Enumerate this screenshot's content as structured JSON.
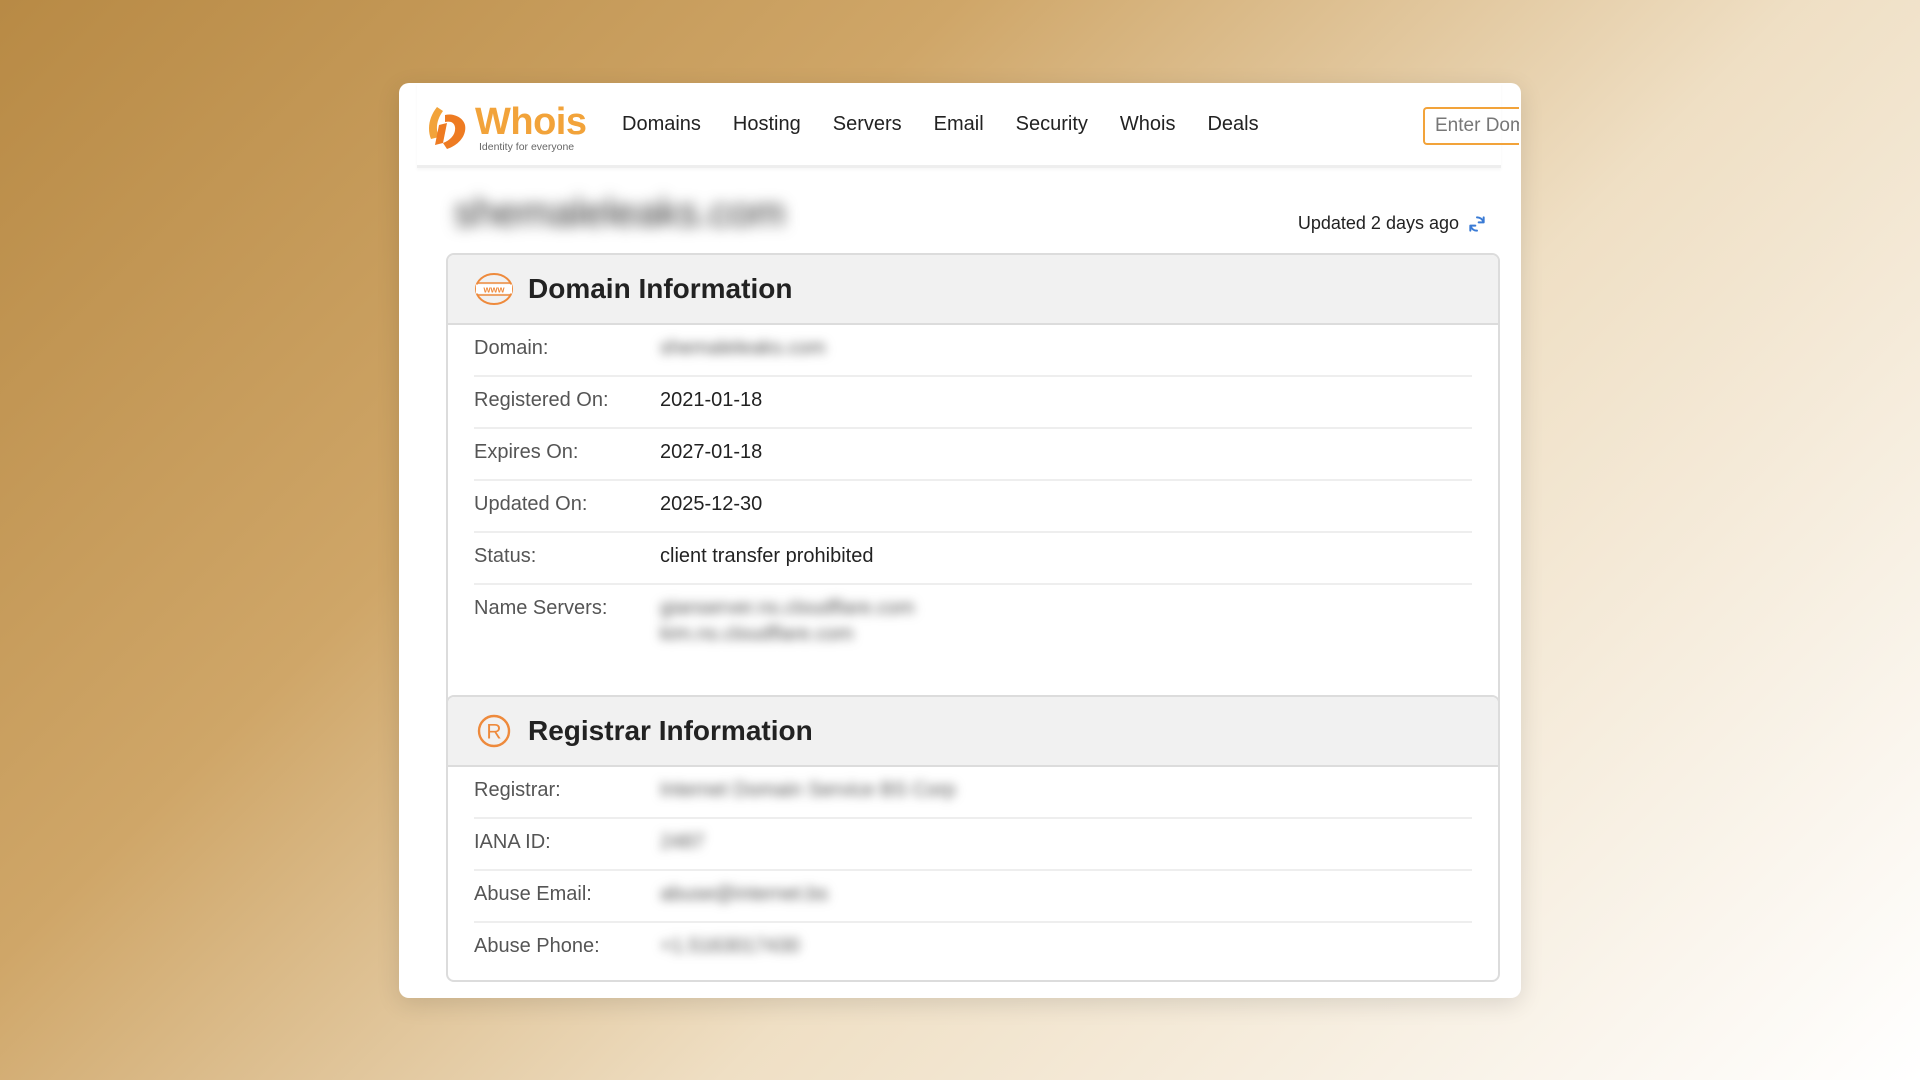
{
  "header": {
    "logo": {
      "word": "Whois",
      "tagline": "Identity for everyone"
    },
    "nav": [
      {
        "label": "Domains"
      },
      {
        "label": "Hosting"
      },
      {
        "label": "Servers"
      },
      {
        "label": "Email"
      },
      {
        "label": "Security"
      },
      {
        "label": "Whois"
      },
      {
        "label": "Deals"
      }
    ],
    "search": {
      "placeholder": "Enter Domain"
    }
  },
  "page": {
    "domain_title": "shemaleleaks.com",
    "updated_text": "Updated 2 days ago"
  },
  "domain_info": {
    "title": "Domain Information",
    "rows": [
      {
        "label": "Domain:",
        "value": "shemaleleaks.com"
      },
      {
        "label": "Registered On:",
        "value": "2021-01-18"
      },
      {
        "label": "Expires On:",
        "value": "2027-01-18"
      },
      {
        "label": "Updated On:",
        "value": "2025-12-30"
      },
      {
        "label": "Status:",
        "value": "client transfer prohibited"
      },
      {
        "label": "Name Servers:",
        "value": "gianserver.ns.cloudflare.com",
        "value2": "kim.ns.cloudflare.com"
      }
    ]
  },
  "registrar_info": {
    "title": "Registrar Information",
    "rows": [
      {
        "label": "Registrar:",
        "value": "Internet Domain Service BS Corp"
      },
      {
        "label": "IANA ID:",
        "value": "2487"
      },
      {
        "label": "Abuse Email:",
        "value": "abuse@internet.bs"
      },
      {
        "label": "Abuse Phone:",
        "value": "+1.5163017430"
      }
    ]
  },
  "colors": {
    "accent": "#f2a33a",
    "refresh": "#3a7bd5"
  },
  "icons": {
    "domain_panel": "www-globe-icon",
    "registrar_panel": "registered-trademark-icon",
    "refresh": "refresh-icon"
  }
}
